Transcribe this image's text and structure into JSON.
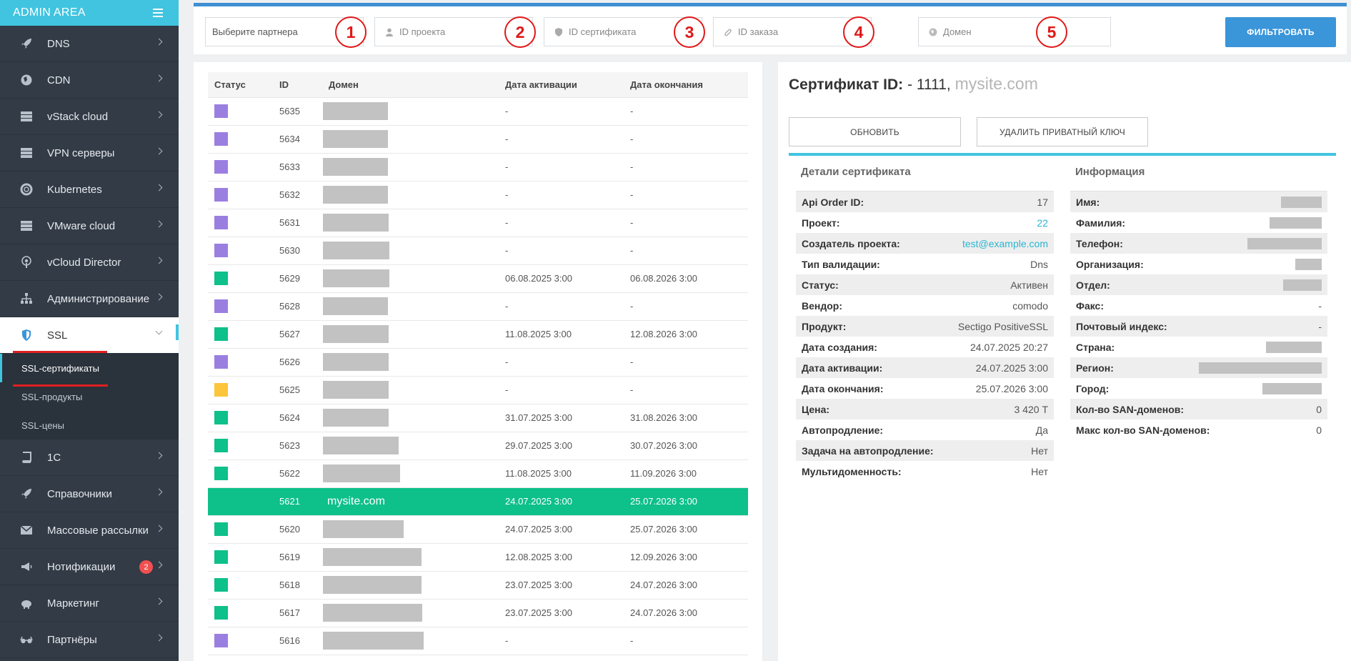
{
  "brand": {
    "title": "ADMIN AREA"
  },
  "sidebar": {
    "items": [
      {
        "label": "DNS",
        "icon": "rocket-icon"
      },
      {
        "label": "CDN",
        "icon": "globe-icon"
      },
      {
        "label": "vStack cloud",
        "icon": "server-icon"
      },
      {
        "label": "VPN серверы",
        "icon": "server-icon"
      },
      {
        "label": "Kubernetes",
        "icon": "lifebuoy-icon"
      },
      {
        "label": "VMware cloud",
        "icon": "server-icon"
      },
      {
        "label": "vCloud Director",
        "icon": "podcast-icon"
      },
      {
        "label": "Администрирование",
        "icon": "sitemap-icon"
      },
      {
        "label": "SSL",
        "icon": "shield-icon"
      }
    ],
    "ssl_sub": [
      "SSL-сертификаты",
      "SSL-продукты",
      "SSL-цены"
    ],
    "items2": [
      {
        "label": "1С",
        "icon": "book-icon"
      },
      {
        "label": "Справочники",
        "icon": "rocket-icon"
      },
      {
        "label": "Массовые рассылки",
        "icon": "envelope-icon"
      },
      {
        "label": "Нотификации",
        "icon": "bullhorn-icon",
        "badge": "2"
      },
      {
        "label": "Маркетинг",
        "icon": "piggy-bank-icon"
      },
      {
        "label": "Партнёры",
        "icon": "glasses-icon"
      }
    ]
  },
  "filters": {
    "partner_placeholder": "Выберите партнера",
    "project_placeholder": "ID проекта",
    "cert_placeholder": "ID сертификата",
    "order_placeholder": "ID заказа",
    "domain_placeholder": "Домен",
    "numbers": [
      "1",
      "2",
      "3",
      "4",
      "5"
    ],
    "button": "ФИЛЬТРОВАТЬ"
  },
  "table": {
    "headers": [
      "Статус",
      "ID",
      "Домен",
      "Дата активации",
      "Дата окончания"
    ],
    "rows": [
      {
        "status": "pending",
        "id": "5635",
        "domain": "",
        "activated": "-",
        "expires": "-"
      },
      {
        "status": "pending",
        "id": "5634",
        "domain": "",
        "activated": "-",
        "expires": "-"
      },
      {
        "status": "pending",
        "id": "5633",
        "domain": "",
        "activated": "-",
        "expires": "-"
      },
      {
        "status": "pending",
        "id": "5632",
        "domain": "",
        "activated": "-",
        "expires": "-"
      },
      {
        "status": "pending",
        "id": "5631",
        "domain": "",
        "activated": "-",
        "expires": "-"
      },
      {
        "status": "pending",
        "id": "5630",
        "domain": "",
        "activated": "-",
        "expires": "-"
      },
      {
        "status": "active",
        "id": "5629",
        "domain": "",
        "activated": "06.08.2025 3:00",
        "expires": "06.08.2026 3:00"
      },
      {
        "status": "pending",
        "id": "5628",
        "domain": "",
        "activated": "-",
        "expires": "-"
      },
      {
        "status": "active",
        "id": "5627",
        "domain": "",
        "activated": "11.08.2025 3:00",
        "expires": "12.08.2026 3:00"
      },
      {
        "status": "pending",
        "id": "5626",
        "domain": "",
        "activated": "-",
        "expires": "-"
      },
      {
        "status": "warning",
        "id": "5625",
        "domain": "",
        "activated": "-",
        "expires": "-"
      },
      {
        "status": "active",
        "id": "5624",
        "domain": "",
        "activated": "31.07.2025 3:00",
        "expires": "31.08.2026 3:00"
      },
      {
        "status": "active",
        "id": "5623",
        "domain": "",
        "activated": "29.07.2025 3:00",
        "expires": "30.07.2026 3:00"
      },
      {
        "status": "active",
        "id": "5622",
        "domain": "",
        "activated": "11.08.2025 3:00",
        "expires": "11.09.2026 3:00"
      },
      {
        "status": "active",
        "id": "5621",
        "domain": "mysite.com",
        "activated": "24.07.2025 3:00",
        "expires": "25.07.2026 3:00",
        "selected": true
      },
      {
        "status": "active",
        "id": "5620",
        "domain": "",
        "activated": "24.07.2025 3:00",
        "expires": "25.07.2026 3:00"
      },
      {
        "status": "active",
        "id": "5619",
        "domain": "",
        "activated": "12.08.2025 3:00",
        "expires": "12.09.2026 3:00"
      },
      {
        "status": "active",
        "id": "5618",
        "domain": "",
        "activated": "23.07.2025 3:00",
        "expires": "24.07.2026 3:00"
      },
      {
        "status": "active",
        "id": "5617",
        "domain": "",
        "activated": "23.07.2025 3:00",
        "expires": "24.07.2026 3:00"
      },
      {
        "status": "pending",
        "id": "5616",
        "domain": "",
        "activated": "-",
        "expires": "-"
      }
    ]
  },
  "status_colors": {
    "pending": "#9b7fe0",
    "active": "#0ec08a",
    "warning": "#fcc53a"
  },
  "detail": {
    "title_label": "Сертификат ID:",
    "title_id": " - 1111,",
    "title_domain": "mysite.com",
    "refresh_button": "ОБНОВИТЬ",
    "delete_key_button": "УДАЛИТЬ ПРИВАТНЫЙ КЛЮЧ",
    "cert_heading": "Детали сертификата",
    "cert_fields": [
      {
        "k": "Api Order ID:",
        "v": "17"
      },
      {
        "k": "Проект:",
        "v": "22",
        "link": true
      },
      {
        "k": "Создатель проекта:",
        "v": "test@example.com",
        "link": true
      },
      {
        "k": "Тип валидации:",
        "v": "Dns"
      },
      {
        "k": "Статус:",
        "v": "Активен"
      },
      {
        "k": "Вендор:",
        "v": "comodo"
      },
      {
        "k": "Продукт:",
        "v": "Sectigo PositiveSSL"
      },
      {
        "k": "Дата создания:",
        "v": "24.07.2025 20:27"
      },
      {
        "k": "Дата активации:",
        "v": "24.07.2025 3:00"
      },
      {
        "k": "Дата окончания:",
        "v": "25.07.2026 3:00"
      },
      {
        "k": "Цена:",
        "v": "3 420 Т"
      },
      {
        "k": "Автопродление:",
        "v": "Да"
      },
      {
        "k": "Задача на автопродление:",
        "v": "Нет"
      },
      {
        "k": "Мультидоменность:",
        "v": "Нет"
      }
    ],
    "info_heading": "Информация",
    "info_fields": [
      {
        "k": "Имя:",
        "v": ""
      },
      {
        "k": "Фамилия:",
        "v": ""
      },
      {
        "k": "Телефон:",
        "v": ""
      },
      {
        "k": "Организация:",
        "v": ""
      },
      {
        "k": "Отдел:",
        "v": ""
      },
      {
        "k": "Факс:",
        "v": "-"
      },
      {
        "k": "Почтовый индекс:",
        "v": "-"
      },
      {
        "k": "Страна:",
        "v": ""
      },
      {
        "k": "Регион:",
        "v": ""
      },
      {
        "k": "Город:",
        "v": ""
      },
      {
        "k": "Кол-во SAN-доменов:",
        "v": "0"
      },
      {
        "k": "Макс кол-во SAN-доменов:",
        "v": "0"
      }
    ]
  }
}
